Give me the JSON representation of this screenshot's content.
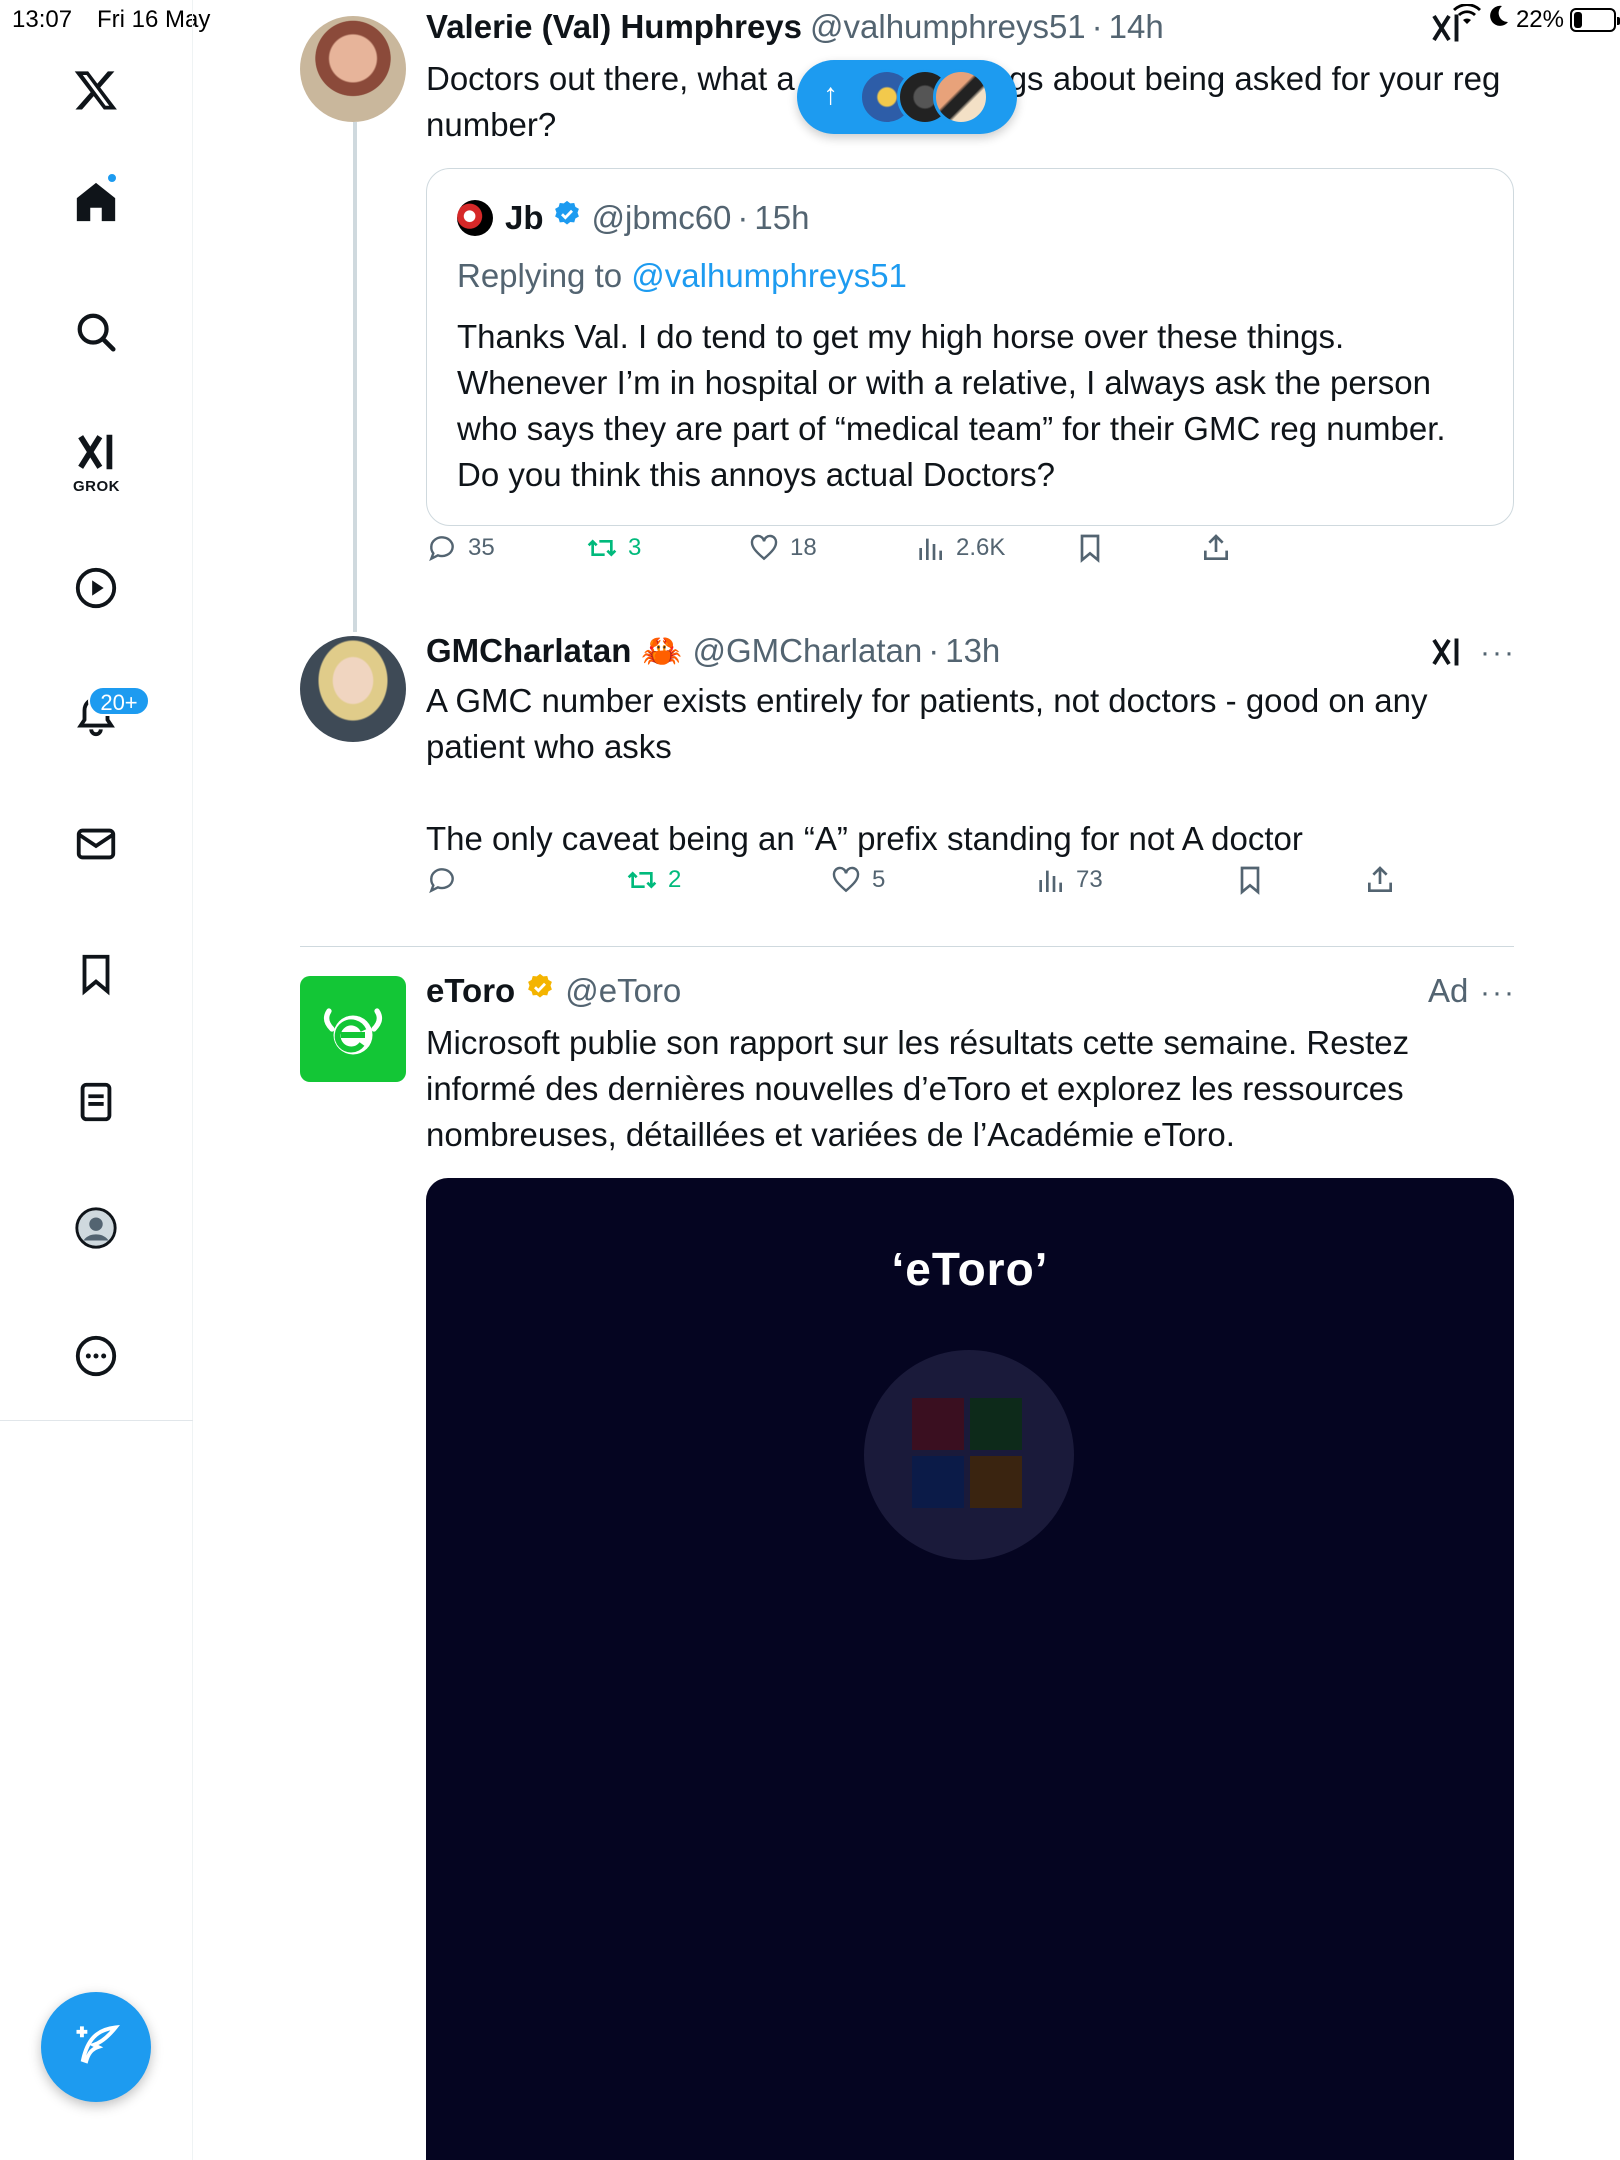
{
  "status_bar": {
    "time": "13:07",
    "date": "Fri 16 May",
    "battery_text": "22%",
    "battery_level": 0.22
  },
  "sidebar": {
    "grok_label": "GROK",
    "notifications_badge": "20+",
    "items": [
      "home-icon",
      "search-icon",
      "grok-icon",
      "video-icon",
      "bell-icon",
      "mail-icon",
      "bookmark-icon",
      "list-icon",
      "profile-icon",
      "more-icon"
    ]
  },
  "new_posts_pill": {
    "arrow": "↑"
  },
  "tweets": [
    {
      "name": "Valerie (Val) Humphreys",
      "handle": "@valhumphreys51",
      "time": "14h",
      "text_line1_start": "Doctors out there, what a",
      "text_line1_end": "gs about being asked for your reg",
      "text_line2": "number?",
      "quote": {
        "name": "Jb",
        "handle": "@jbmc60",
        "time": "15h",
        "replying_prefix": "Replying to",
        "replying_to": "@valhumphreys51",
        "text": "Thanks Val. I do tend to get my high horse over these things. Whenever I’m in hospital or with a relative, I always ask the person who says they are part of “medical team” for their GMC reg number. Do you think this annoys actual Doctors?"
      },
      "stats": {
        "replies": "35",
        "reposts": "3",
        "likes": "18",
        "views": "2.6K"
      }
    },
    {
      "name": "GMCharlatan",
      "emoji": "🦀",
      "handle": "@GMCharlatan",
      "time": "13h",
      "text_para1": "A GMC number exists entirely for patients, not doctors - good on any patient who asks",
      "text_para2": "The only caveat being an “A” prefix standing for not A doctor",
      "stats": {
        "replies": "",
        "reposts": "2",
        "likes": "5",
        "views": "73"
      }
    },
    {
      "name": "eToro",
      "handle": "@eToro",
      "ad_label": "Ad",
      "text": "Microsoft publie son rapport sur les résultats cette semaine. Restez informé des dernières nouvelles d’eToro et explorez les ressources nombreuses, détaillées et variées de l’Académie eToro.",
      "media_logo": "‘eToro’"
    }
  ],
  "colors": {
    "accent": "#1d9bf0",
    "repost_green": "#00ba7c",
    "muted": "#536471",
    "media_bg": "#050521",
    "gold_check": "#f4b400"
  }
}
